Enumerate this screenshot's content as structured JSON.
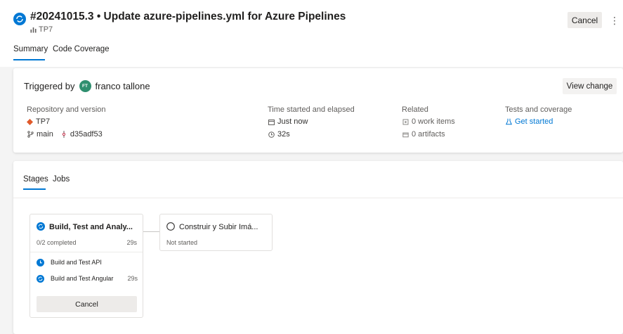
{
  "header": {
    "title": "#20241015.3 • Update azure-pipelines.yml for Azure Pipelines",
    "repo": "TP7",
    "cancel_label": "Cancel",
    "more_label": "⋮",
    "tabs": [
      {
        "label": "Summary",
        "active": true
      },
      {
        "label": "Code Coverage",
        "active": false
      }
    ]
  },
  "summary": {
    "triggered_prefix": "Triggered by",
    "user_initials": "FT",
    "user_name": "franco tallone",
    "view_change_label": "View change",
    "repository": {
      "heading": "Repository and version",
      "repo_name": "TP7",
      "branch": "main",
      "commit": "d35adf53"
    },
    "time": {
      "heading": "Time started and elapsed",
      "started": "Just now",
      "elapsed": "32s"
    },
    "related": {
      "heading": "Related",
      "work_items": "0 work items",
      "artifacts": "0 artifacts"
    },
    "tests": {
      "heading": "Tests and coverage",
      "link": "Get started"
    }
  },
  "stages": {
    "tabs": [
      {
        "label": "Stages",
        "active": true
      },
      {
        "label": "Jobs",
        "active": false
      }
    ],
    "items": [
      {
        "name": "Build, Test and Analy...",
        "status": "running",
        "progress": "0/2 completed",
        "time": "29s",
        "jobs": [
          {
            "name": "Build and Test API",
            "status": "queued",
            "time": ""
          },
          {
            "name": "Build and Test Angular",
            "status": "running",
            "time": "29s"
          }
        ],
        "cancel_label": "Cancel"
      },
      {
        "name": "Construir y Subir Imá...",
        "status": "not-started",
        "progress": "Not started"
      }
    ]
  },
  "colors": {
    "accent": "#0078d4",
    "avatar": "#2f8f6f",
    "repo_icon": "#e05a2b"
  }
}
